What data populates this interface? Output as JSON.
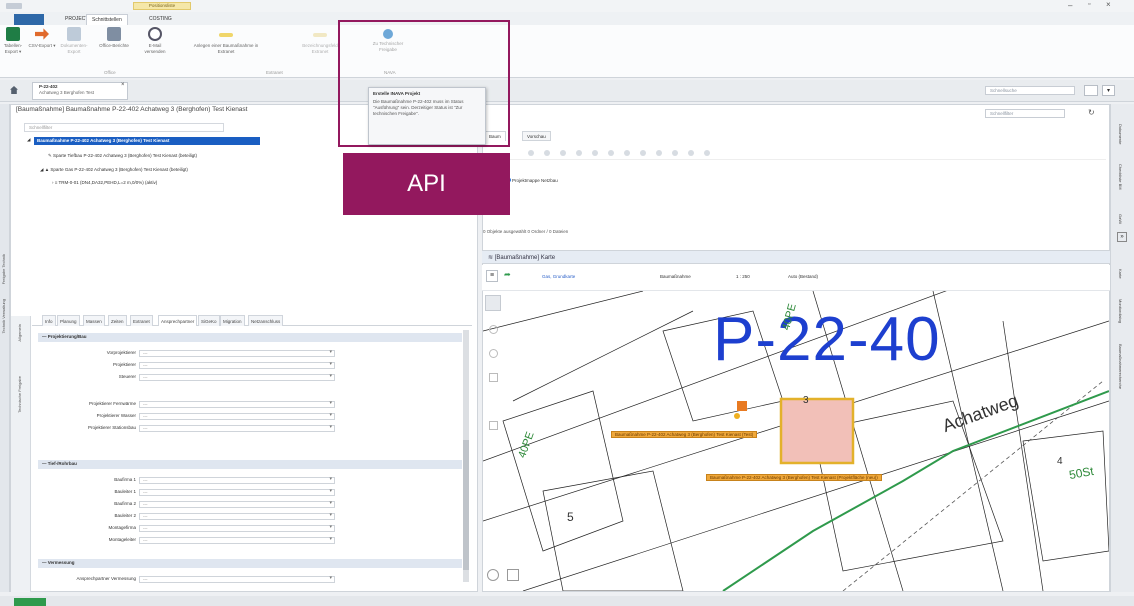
{
  "ribbon": {
    "context_pill": "Positionsliste",
    "tabs": [
      "PROJECT",
      "Schnittstellen",
      "COSTING"
    ],
    "buttons": [
      {
        "label": "Tabellen-Export ▾",
        "icon": "excel-icon"
      },
      {
        "label": "CSV-Export ▾",
        "icon": "csv-export-icon"
      },
      {
        "label": "Dokumenten-Export",
        "icon": "document-export-icon"
      },
      {
        "label": "Office-Berichte",
        "icon": "report-icon"
      },
      {
        "label": "E-Mail versenden",
        "icon": "email-icon"
      },
      {
        "label": "Anlegen einer Baumaßnahme in Extranet",
        "icon": "create-icon"
      },
      {
        "label": "Bezeichnungsfeld Extranet",
        "icon": "extranet-icon"
      },
      {
        "label": "Zu Technischer Freigabe",
        "icon": "approval-icon"
      }
    ],
    "groups": [
      "Office",
      "Extranet",
      "NAVA"
    ]
  },
  "tooltip": {
    "title": "Erstelle INAVA Projekt",
    "body": "Die Baumaßnahme P-22-402 muss im Status \"Ausführung\" sein. Derzeitiger Status ist \"Zur technischen Freigabe\"."
  },
  "annotation": {
    "label": "API"
  },
  "document_tab": {
    "title": "P-22-402",
    "subtitle": "Achatweg 3 Berghofen Test"
  },
  "left_pane": {
    "breadcrumb": "[Baumaßnahme] Baumaßnahme P-22-402 Achatweg 3 (Berghofen) Test Kienast",
    "search_placeholder": "Schnellfilter",
    "tree": {
      "selected": "Baumaßnahme P-22-402 Achatweg 3 (Berghofen) Test Kienast",
      "items": [
        "Sparte Tiefbau P-22-402 Achatweg 3 (Berghofen) Test Kienast (beteiligt)",
        "Sparte Gas P-22-402 Achatweg 3 (Berghofen) Test Kienast (beteiligt)",
        "TRM-0-01 (DN4,DA32,PEHD,L=2 m,0/0%) (aktiv)"
      ]
    },
    "side_labels": [
      "Freigabe Technik",
      "Technik Verwaltung"
    ],
    "property_tabs": [
      "Info",
      "Planung",
      "Massen",
      "Zeiten",
      "Extranet",
      "Ansprechpartner",
      "SiGeKo",
      "Migration",
      "Netzanschluss"
    ],
    "property_side_labels": [
      "Allgemein",
      "Technische Freigabe"
    ],
    "sections": [
      {
        "title": "Projektierung/Bau",
        "fields": [
          "Vorprojektierer",
          "Projektierer",
          "Steuerer",
          "Projektierer Fernwärme",
          "Projektierer Wasser",
          "Projektierer Stationsbau"
        ]
      },
      {
        "title": "Tief-/Rohrbau",
        "fields": [
          "Baufirma 1",
          "Bauleiter 1",
          "Baufirma 2",
          "Bauleiter 2",
          "Montagefirma",
          "Montageleiter"
        ]
      },
      {
        "title": "Vermessung",
        "fields": [
          "Ansprechpartner Vermessung"
        ]
      }
    ],
    "empty_value": "---"
  },
  "right_pane": {
    "search_placeholder": "Schnellsuche",
    "filter_placeholder": "Schnellfilter",
    "sub_tabs": [
      "Baum",
      "Vorschau"
    ],
    "project_folder": "Projektmappe Netzbau",
    "status": "0 Objekte ausgewählt 0 Ordner / 0 Dateien",
    "map_title": "[Baumaßnahme] Karte",
    "map_toolbar": {
      "layer": "Gas, Grundkarte",
      "context": "Baumaßnahme",
      "scale": "1 : 250",
      "mode": "Auto (Bestand)"
    },
    "side_labels": [
      "Dokumente",
      "Checkliste BM",
      "GaWi",
      "Karte",
      "Monitordialog",
      "Baumaßnahmerecherche"
    ]
  },
  "map": {
    "big_label": "P-22-40",
    "street": "Achatweg",
    "tags": [
      "40PE",
      "40PE",
      "50St"
    ],
    "house_numbers": [
      "3",
      "4",
      "5"
    ],
    "label_1": "Baumaßnahme P-22-402 Achatweg 3 (Berghofen) Test Kienast (Test)",
    "label_2": "Baumaßnahme P-22-402 Achatweg 3 (Berghofen) Test Kienast (Projektfläche (neu))"
  },
  "colors": {
    "accent": "#93185e",
    "selection": "#1a5ec2",
    "map_text": "#1d3fcf",
    "label": "#f0a83a",
    "pipe": "#2f9a4c"
  }
}
